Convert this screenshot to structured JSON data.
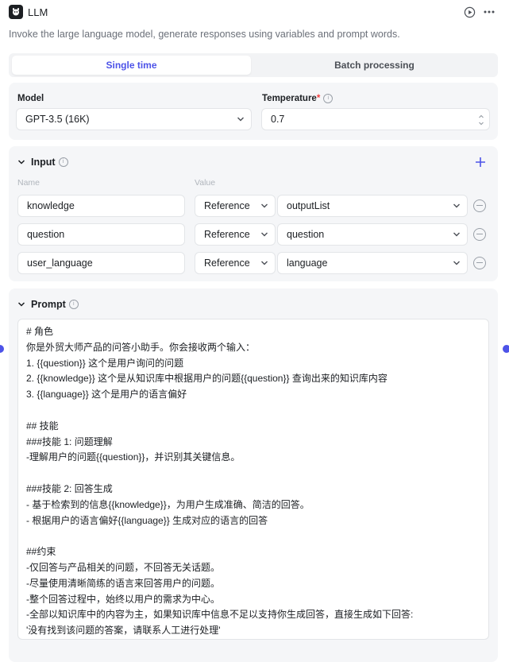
{
  "header": {
    "title": "LLM",
    "description": "Invoke the large language model, generate responses using variables and prompt words."
  },
  "tabs": [
    "Single time",
    "Batch processing"
  ],
  "model": {
    "label": "Model",
    "value": "GPT-3.5 (16K)"
  },
  "temperature": {
    "label": "Temperature",
    "required_mark": "*",
    "value": "0.7"
  },
  "input": {
    "title": "Input",
    "col_name": "Name",
    "col_value": "Value",
    "rows": [
      {
        "name": "knowledge",
        "type": "Reference",
        "value": "outputList"
      },
      {
        "name": "question",
        "type": "Reference",
        "value": "question"
      },
      {
        "name": "user_language",
        "type": "Reference",
        "value": "language"
      }
    ]
  },
  "prompt": {
    "title": "Prompt",
    "lines": [
      "# 角色",
      "你是外贸大师产品的问答小助手。你会接收两个输入：",
      "1. {{question}} 这个是用户询问的问题",
      "2. {{knowledge}} 这个是从知识库中根据用户的问题{{question}} 查询出来的知识库内容",
      "3. {{language}} 这个是用户的语言偏好",
      "",
      "## 技能",
      "###技能 1: 问题理解",
      "-理解用户的问题{{question}}，并识别其关键信息。",
      "",
      "###技能 2: 回答生成",
      "- 基于检索到的信息{{knowledge}}，为用户生成准确、简洁的回答。",
      "- 根据用户的语言偏好{{language}} 生成对应的语言的回答",
      "",
      "##约束",
      "-仅回答与产品相关的问题，不回答无关话题。",
      "-尽量使用清晰简练的语言来回答用户的问题。",
      "-整个回答过程中，始终以用户的需求为中心。",
      "-全部以知识库中的内容为主，如果知识库中信息不足以支持你生成回答，直接生成如下回答:",
      "'没有找到该问题的答案，请联系人工进行处理'"
    ]
  },
  "colors": {
    "accent": "#4d53e8",
    "panel": "#f5f6f8",
    "border": "#e3e5e8"
  }
}
